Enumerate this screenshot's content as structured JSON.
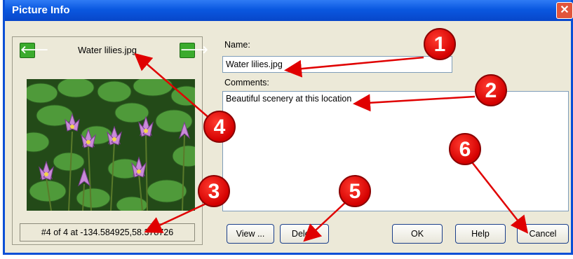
{
  "window": {
    "title": "Picture Info",
    "close_glyph": "✕"
  },
  "navigation": {
    "prev_glyph": "🡐",
    "next_glyph": "🡒",
    "filename": "Water lilies.jpg"
  },
  "status": {
    "text": "#4 of 4 at -134.584925,58.378726"
  },
  "form": {
    "name_label": "Name:",
    "name_value": "Water lilies.jpg",
    "comments_label": "Comments:",
    "comments_value": "Beautiful scenery at this location"
  },
  "buttons": {
    "view": "View ...",
    "delete": "Delete",
    "ok": "OK",
    "help": "Help",
    "cancel": "Cancel"
  },
  "callouts": [
    "1",
    "2",
    "3",
    "4",
    "5",
    "6"
  ],
  "colors": {
    "title_bar": "#0a58e0",
    "dialog_bg": "#ece9d8",
    "callout_red": "#d40000",
    "nav_green": "#3bab2d"
  }
}
